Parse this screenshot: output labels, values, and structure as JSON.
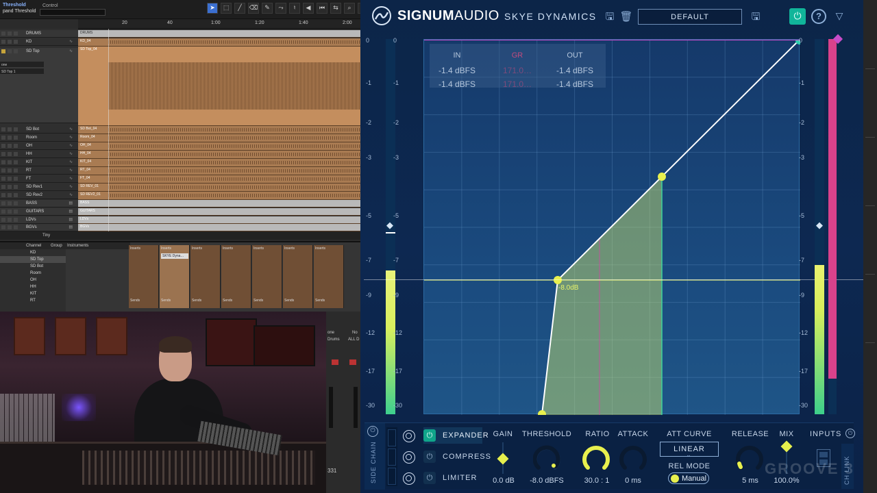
{
  "daw": {
    "window_title": "pand Threshold",
    "window_title_line1": "Threshold",
    "control_label": "Control",
    "ruler_ticks": [
      "20",
      "40",
      "1:00",
      "1:20",
      "1:40",
      "2:00"
    ],
    "tracks": [
      {
        "name": "DRUMS",
        "kind": "folder"
      },
      {
        "name": "KD",
        "kind": "audio"
      },
      {
        "name": "SD Top",
        "kind": "audio",
        "selected": true
      },
      {
        "name": "SD Bot",
        "kind": "audio"
      },
      {
        "name": "Room",
        "kind": "audio"
      },
      {
        "name": "OH",
        "kind": "audio"
      },
      {
        "name": "HH",
        "kind": "audio"
      },
      {
        "name": "KIT",
        "kind": "audio"
      },
      {
        "name": "RT",
        "kind": "audio"
      },
      {
        "name": "FT",
        "kind": "audio"
      },
      {
        "name": "SD Rev1",
        "kind": "audio"
      },
      {
        "name": "SD Rev2",
        "kind": "audio"
      },
      {
        "name": "BASS",
        "kind": "folder"
      },
      {
        "name": "GUITARS",
        "kind": "folder"
      },
      {
        "name": "LDVs",
        "kind": "folder"
      },
      {
        "name": "BGVs",
        "kind": "folder"
      }
    ],
    "selected_track_input": "one",
    "selected_track_output": "SD Top 1",
    "clips": {
      "drums": "DRUMS",
      "kd": "KD_04",
      "sdtop": "SD Top_04",
      "sdbot": "SD Bot_04",
      "room": "Room_04",
      "oh": "OH_04",
      "hh": "HH_04",
      "kit": "KIT_04",
      "rt": "RT_04",
      "ft": "FT_04",
      "rev1": "SD REV_01",
      "rev2": "SD REV2_01",
      "bass": "BASS",
      "guitars": "GUITARS",
      "ldvs": "LDVs",
      "bgvs": "BGVs"
    },
    "size_label": "Tiny",
    "mixer": {
      "tab_channel": "Channel",
      "tab_group": "Group",
      "tab_instruments": "Instruments",
      "channels": [
        "KD",
        "SD Top",
        "SD Bot",
        "Room",
        "OH",
        "HH",
        "KIT",
        "RT"
      ],
      "inserts_label": "Inserts",
      "sends_label": "Sends",
      "plugin_insert": "SKYE Dyna…"
    },
    "strip_labels": {
      "one": "one",
      "no": "No",
      "drums": "Drums",
      "alldr": "ALL D",
      "num": "331"
    }
  },
  "plugin": {
    "brand_bold": "SIGNUM",
    "brand_light": "AUDIO",
    "product": "SKYE DYNAMICS",
    "preset": "DEFAULT",
    "meter_scale_left": [
      "0",
      "-1",
      "-2",
      "-3",
      "-5",
      "-7",
      "-9",
      "-12",
      "-17",
      "-30"
    ],
    "meter_scale_inner": [
      "0",
      "-1",
      "-2",
      "-3",
      "-5",
      "-7",
      "-9",
      "-12",
      "-17",
      "-30"
    ],
    "meter_scale_right": [
      "0",
      "-1",
      "-2",
      "-3",
      "-5",
      "-7",
      "-9",
      "-12",
      "-17",
      "-30"
    ],
    "readout": {
      "in_label": "IN",
      "gr_label": "GR",
      "out_label": "OUT",
      "in_l": "-1.4 dBFS",
      "in_r": "-1.4 dBFS",
      "gr_l": "171.0…",
      "gr_r": "171.0…",
      "out_l": "-1.4 dBFS",
      "out_r": "-1.4 dBFS"
    },
    "threshold_label": "-8.0dB",
    "modes": [
      {
        "label": "EXPANDER",
        "on": true
      },
      {
        "label": "COMPRESS",
        "on": false
      },
      {
        "label": "LIMITER",
        "on": false
      }
    ],
    "sidechain_label": "SIDE CHAIN",
    "controls": {
      "gain_label": "GAIN",
      "gain_value": "0.0 dB",
      "threshold_label": "THRESHOLD",
      "threshold_value": "-8.0 dBFS",
      "ratio_label": "RATIO",
      "ratio_value": "30.0 : 1",
      "attack_label": "ATTACK",
      "attack_value": "0 ms",
      "att_curve_label": "ATT CURVE",
      "att_curve_value": "LINEAR",
      "rel_mode_label": "REL MODE",
      "rel_mode_value": "Manual",
      "release_label": "RELEASE",
      "release_value": "5 ms",
      "mix_label": "MIX",
      "mix_value": "100.0%",
      "inputs_label": "INPUTS",
      "ch_link_label": "CH LINK"
    },
    "colors": {
      "accent_teal": "#11b59a",
      "curve_yellow": "#e8f04e",
      "gr_pink": "#d9428b",
      "bg_blue": "#0c2548"
    }
  },
  "watermark": "GROOVE 3"
}
